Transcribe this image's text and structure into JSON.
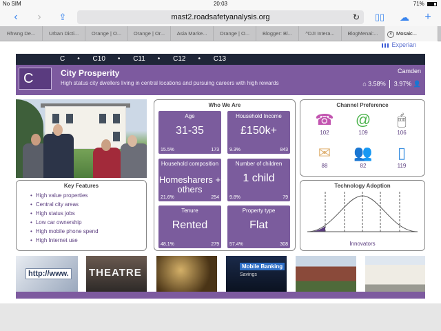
{
  "status": {
    "carrier": "No SIM",
    "time": "20:03",
    "battery": "71%",
    "battery_level": 0.71
  },
  "browser": {
    "url": "mast2.roadsafetyanalysis.org",
    "tabs": [
      "Rhwng De...",
      "Urban Dicti...",
      "Orange | O...",
      "Orange | Or...",
      "Asia Marke...",
      "Orange | O...",
      "Blogger: Bl...",
      "^DJI Intera...",
      "BlogMenai:...",
      "Mosaic..."
    ],
    "icons": {
      "back": "chevron-left-icon",
      "forward": "chevron-right-icon",
      "share": "share-icon",
      "reload": "reload-icon",
      "bookmarks": "book-icon",
      "cloud": "cloud-icon",
      "new_tab": "plus-icon",
      "close_tab": "close-icon"
    }
  },
  "brand": {
    "name": "Experian"
  },
  "codes": [
    "C",
    "C10",
    "C11",
    "C12",
    "C13"
  ],
  "header": {
    "letter": "C",
    "title": "City Prosperity",
    "subtitle": "High status city dwellers living in central locations and pursuing careers with high rewards",
    "region": "Camden",
    "stat_home": "3.58%",
    "stat_person": "3.97%",
    "color": "#7d5a9f"
  },
  "features": {
    "title": "Key Features",
    "items": [
      "High value properties",
      "Central city areas",
      "High status jobs",
      "Low car ownership",
      "High mobile phone spend",
      "High Internet use"
    ]
  },
  "who": {
    "title": "Who We Are",
    "tiles": [
      {
        "label": "Age",
        "value": "31-35",
        "left": "15.5%",
        "right": "173"
      },
      {
        "label": "Household Income",
        "value": "£150k+",
        "left": "9.3%",
        "right": "843"
      },
      {
        "label": "Household composition",
        "value": "Homesharers + others",
        "left": "21.6%",
        "right": "254"
      },
      {
        "label": "Number of children",
        "value": "1 child",
        "left": "9.8%",
        "right": "79"
      },
      {
        "label": "Tenure",
        "value": "Rented",
        "left": "48.1%",
        "right": "279"
      },
      {
        "label": "Property type",
        "value": "Flat",
        "left": "57.4%",
        "right": "308"
      }
    ]
  },
  "channel": {
    "title": "Channel Preference",
    "items": [
      {
        "icon": "phone-icon",
        "value": "102",
        "color": "#c255b0"
      },
      {
        "icon": "email-icon",
        "value": "109",
        "color": "#4bb34b"
      },
      {
        "icon": "mouse-icon",
        "value": "106",
        "color": "#555555"
      },
      {
        "icon": "letter-icon",
        "value": "88",
        "color": "#e8c28a"
      },
      {
        "icon": "people-icon",
        "value": "82",
        "color": "#d84a4a"
      },
      {
        "icon": "mobile-icon",
        "value": "119",
        "color": "#3a8fe0"
      }
    ]
  },
  "adoption": {
    "title": "Technology Adoption",
    "label": "Innovators"
  },
  "thumbs": {
    "web": "http://www.",
    "theatre": "THEATRE",
    "banking": "Mobile Banking",
    "savings": "Savings"
  }
}
